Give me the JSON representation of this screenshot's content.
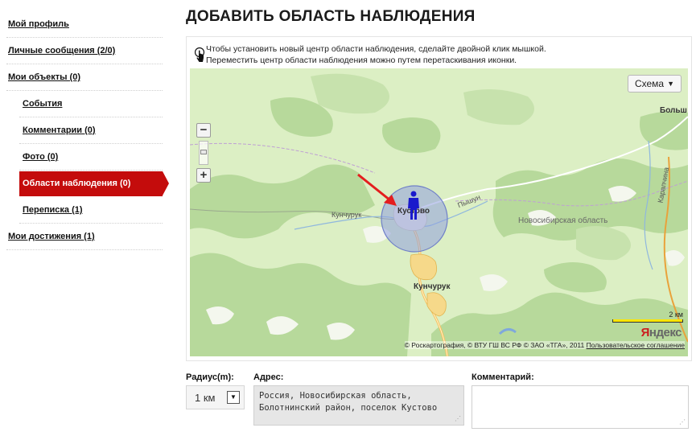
{
  "sidebar": {
    "items": [
      {
        "label": "Мой профиль"
      },
      {
        "label": "Личные сообщения (2/0)"
      },
      {
        "label": "Мои объекты  (0)"
      },
      {
        "label": "События"
      },
      {
        "label": "Комментарии (0)"
      },
      {
        "label": "Фото (0)"
      },
      {
        "label": "Области наблюдения (0)"
      },
      {
        "label": "Переписка (1)"
      },
      {
        "label": "Мои достижения  (1)"
      }
    ]
  },
  "page": {
    "title": "ДОБАВИТЬ ОБЛАСТЬ НАБЛЮДЕНИЯ"
  },
  "hint": {
    "line1": "Чтобы установить новый центр области наблюдения, сделайте двойной клик мышкой.",
    "line2": "Переместить центр области наблюдения можно путем перетаскивания иконки."
  },
  "map": {
    "scheme_label": "Схема",
    "scheme_arrow": "▼",
    "zoom_in": "+",
    "zoom_out": "−",
    "places": {
      "kustovo": "Кустово",
      "kunchuruk": "Кунчурук",
      "kunchuruk_river": "Кунчурук",
      "pyshun": "Пышун",
      "region": "Новосибирская область",
      "bolsh": "Больш",
      "karapchina": "Карапчина"
    },
    "scale_label": "2 км",
    "logo_y": "Я",
    "logo_rest": "ндекс",
    "copyright": "© Роскартография, © ВТУ ГШ ВС РФ © ЗАО «ТГА», 2011",
    "agreement": "Пользовательское соглашение",
    "colors": {
      "land": "#dcefc4",
      "forest": "#b6d89a",
      "marker": "#1a1acc",
      "circle": "#8f9fe0",
      "arrow": "#e41e1e"
    }
  },
  "form": {
    "radius_label": "Радиус(m):",
    "radius_value": "1 км",
    "radius_arrow": "▼",
    "address_label": "Адрес:",
    "address_line1": "Россия, Новосибирская область,",
    "address_line2": "Болотнинский район, поселок Кустово",
    "comment_label": "Комментарий:"
  }
}
